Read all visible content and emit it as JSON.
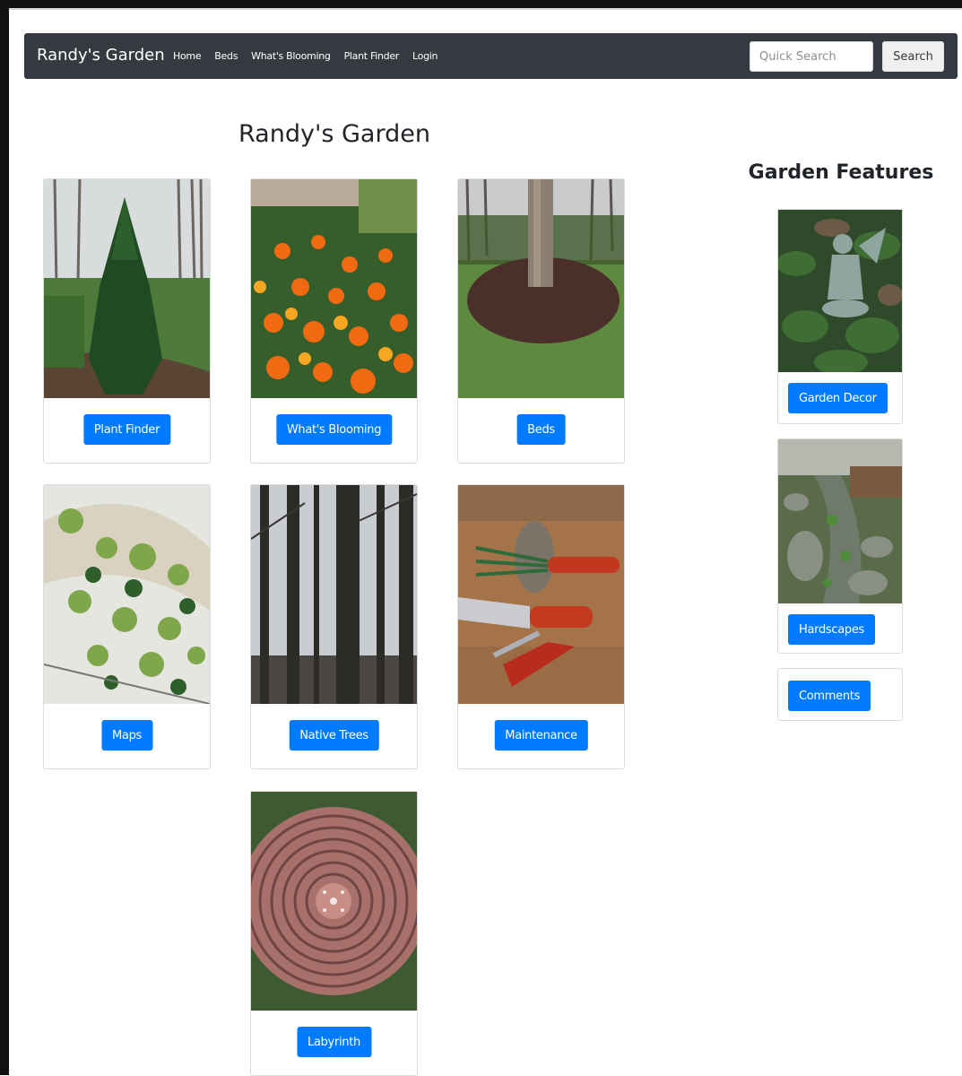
{
  "navbar": {
    "brand": "Randy's Garden",
    "links": [
      "Home",
      "Beds",
      "What's Blooming",
      "Plant Finder",
      "Login"
    ],
    "search_placeholder": "Quick Search",
    "search_button": "Search"
  },
  "page_title": "Randy's Garden",
  "cards": [
    {
      "label": "Plant Finder",
      "icon": "evergreen-tree-photo"
    },
    {
      "label": "What's Blooming",
      "icon": "orange-zinnias-photo"
    },
    {
      "label": "Beds",
      "icon": "mulched-bed-photo"
    },
    {
      "label": "Maps",
      "icon": "garden-plan-photo"
    },
    {
      "label": "Native Trees",
      "icon": "forest-trunks-photo"
    },
    {
      "label": "Maintenance",
      "icon": "garden-tools-photo"
    },
    {
      "label": "Labyrinth",
      "icon": "brick-labyrinth-photo"
    }
  ],
  "features": {
    "title": "Garden Features",
    "items": [
      {
        "label": "Garden Decor",
        "icon": "fairy-statue-photo"
      },
      {
        "label": "Hardscapes",
        "icon": "stone-stream-photo"
      },
      {
        "label": "Comments"
      }
    ]
  },
  "colors": {
    "navbar": "#343a40",
    "primary": "#007bff"
  }
}
